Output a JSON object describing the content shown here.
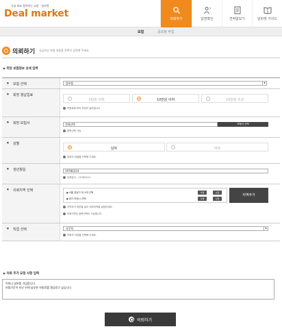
{
  "header": {
    "tagline": "국내 최초 협력하는 쇼핑 · 딜마켓",
    "logo_prefix": "D",
    "logo_rest": "eal market",
    "nav": [
      {
        "label": "의뢰하기",
        "icon": "search-person-icon",
        "active": true
      },
      {
        "label": "답변확인",
        "icon": "person-question-icon",
        "active": false
      },
      {
        "label": "견적알보기",
        "icon": "document-icon",
        "active": false
      },
      {
        "label": "딜마켓 가이드",
        "icon": "book-icon",
        "active": false
      }
    ]
  },
  "subnav": {
    "item1": "보험",
    "item2": "공조정 부입"
  },
  "page": {
    "title": "의뢰하기",
    "subtitle": "궁금하신 보험 내용을 정확히 입력해 주세요.",
    "section1": "희망 보험정보 상세 입력",
    "section2": "의뢰 추가 요청 사항 입력"
  },
  "form": {
    "insurance_type": {
      "label": "보험 선택",
      "value": "암보험"
    },
    "monthly_premium": {
      "label": "희망 월납입료",
      "options": [
        "3만원 이하",
        "10만원 이하",
        "10만원 이상"
      ],
      "selected_index": 1,
      "hint": "보험료에 따라 보장이 달라집니다"
    },
    "insurer": {
      "label": "희망 보험사",
      "value": "전체선택",
      "button": "보험사 선택",
      "hint": "중복선택 가능"
    },
    "gender": {
      "label": "성별",
      "options": [
        "남자",
        "여자"
      ],
      "selected_index": 0,
      "hint": "의뢰자 성별을 선택해 주세요."
    },
    "birthdate": {
      "label": "생년월일",
      "value": "19780224",
      "hint": "입력방식 : 19780224"
    },
    "region": {
      "label": "의뢰지역 선택",
      "regions": [
        "서울 강남구 외 4개 선택",
        "경기 안양시 선택"
      ],
      "delete_label": "삭제",
      "edit_label": "수정",
      "add_button": "지역추가",
      "hint1": "지역추가 버튼을 눌러 의뢰지역을 설정하세요.",
      "hint2": "의뢰지역은 중복선택이 가능합니다."
    },
    "occupation": {
      "label": "직업 선택",
      "value": "사무직",
      "hint": "의뢰자 직업을 선택해 주세요."
    }
  },
  "request": {
    "line1": "어머니 암보험 가입합니다.",
    "line2": "보험기간이 지난 뒤에 납부한 보험료를 환급받고 싶습니다."
  },
  "submit_label": "의뢰하기"
}
